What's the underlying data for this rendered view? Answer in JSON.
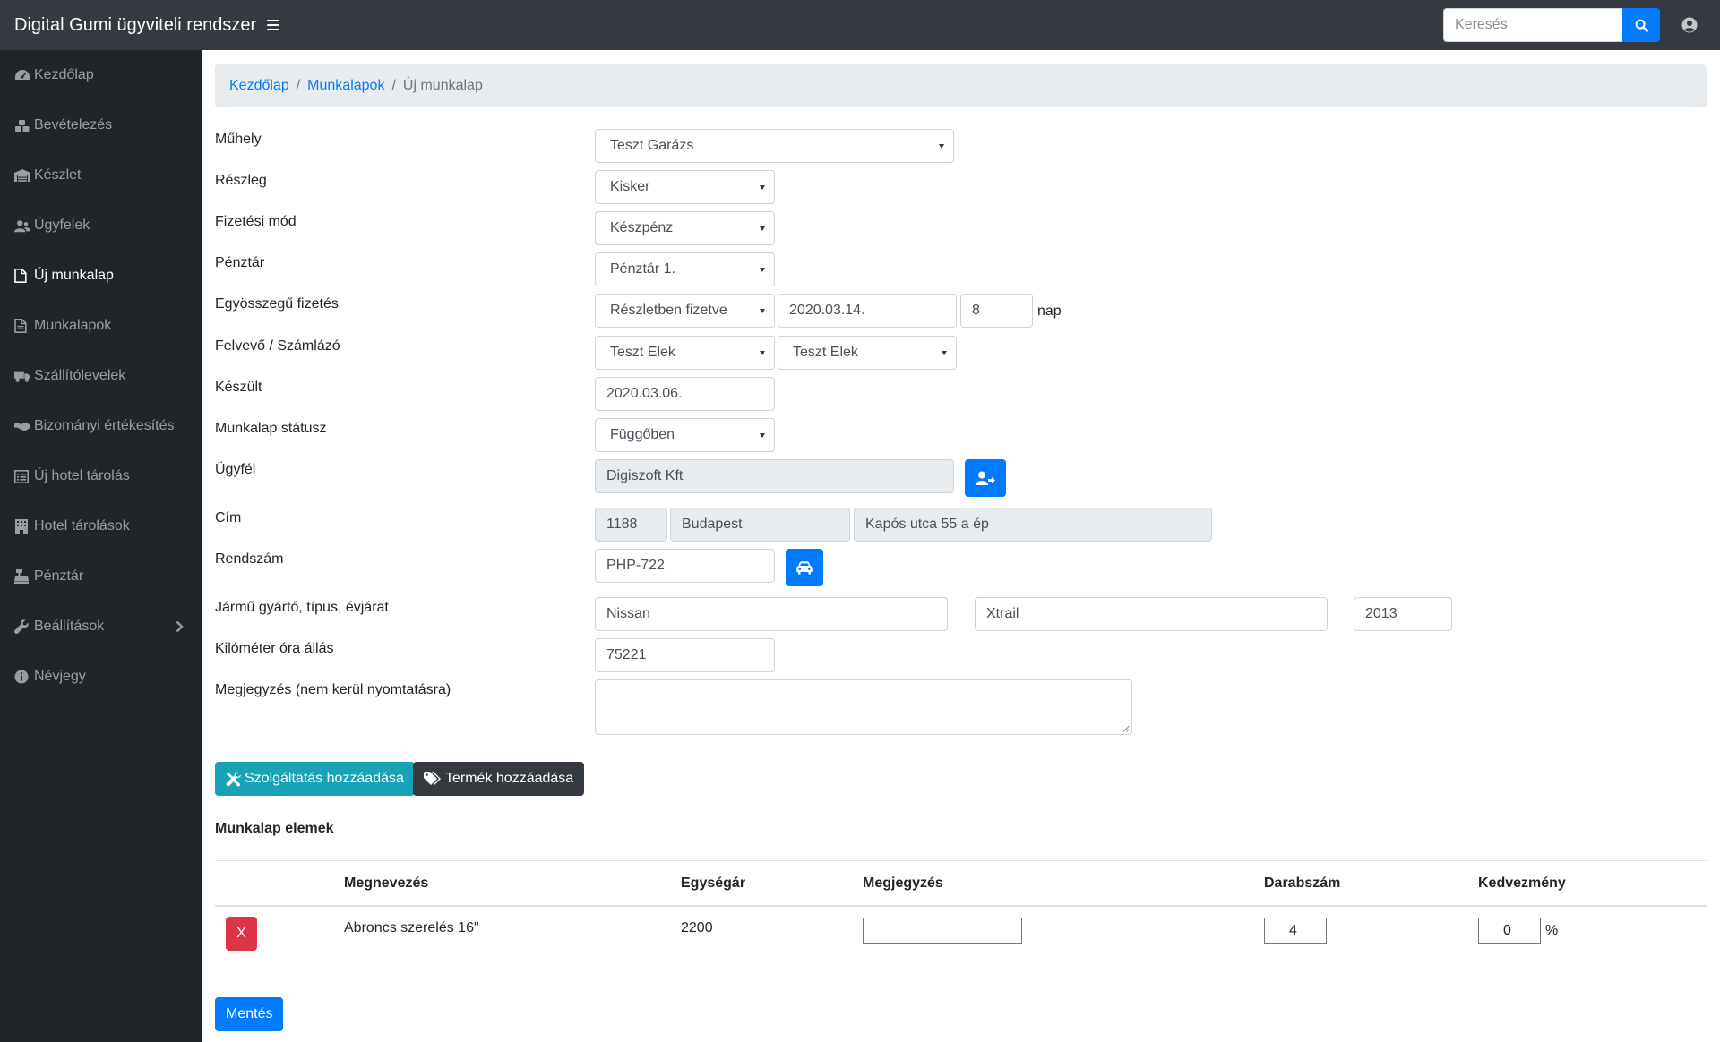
{
  "app": {
    "title": "Digital Gumi ügyviteli rendszer",
    "search_placeholder": "Keresés"
  },
  "sidebar": {
    "items": [
      {
        "label": "Kezdőlap",
        "icon": "tachometer-icon"
      },
      {
        "label": "Bevételezés",
        "icon": "cubes-icon"
      },
      {
        "label": "Készlet",
        "icon": "warehouse-icon"
      },
      {
        "label": "Ügyfelek",
        "icon": "users-icon"
      },
      {
        "label": "Új munkalap",
        "icon": "file-icon",
        "active": true
      },
      {
        "label": "Munkalapok",
        "icon": "file-text-icon"
      },
      {
        "label": "Szállítólevelek",
        "icon": "truck-icon"
      },
      {
        "label": "Bizományi értékesítés",
        "icon": "handshake-icon"
      },
      {
        "label": "Új hotel tárolás",
        "icon": "list-icon"
      },
      {
        "label": "Hotel tárolások",
        "icon": "building-icon"
      },
      {
        "label": "Pénztár",
        "icon": "cash-register-icon"
      },
      {
        "label": "Beállítások",
        "icon": "wrench-icon"
      },
      {
        "label": "Névjegy",
        "icon": "info-icon"
      }
    ]
  },
  "breadcrumb": {
    "home": "Kezdőlap",
    "worksheets": "Munkalapok",
    "current": "Új munkalap"
  },
  "form": {
    "muhely": {
      "label": "Műhely",
      "value": "Teszt Garázs"
    },
    "reszleg": {
      "label": "Részleg",
      "value": "Kisker"
    },
    "fizetesi_mod": {
      "label": "Fizetési mód",
      "value": "Készpénz"
    },
    "penztar": {
      "label": "Pénztár",
      "value": "Pénztár 1."
    },
    "egyosszegu": {
      "label": "Egyösszegű fizetés",
      "value": "Részletben fizetve",
      "date": "2020.03.14.",
      "days": "8",
      "days_suffix": "nap"
    },
    "felvevo": {
      "label": "Felvevő / Számlázó",
      "felvevo": "Teszt Elek",
      "szamlazo": "Teszt Elek"
    },
    "keszult": {
      "label": "Készült",
      "value": "2020.03.06."
    },
    "statusz": {
      "label": "Munkalap státusz",
      "value": "Függőben"
    },
    "ugyfel": {
      "label": "Ügyfél",
      "value": "Digiszoft Kft"
    },
    "cim": {
      "label": "Cím",
      "zip": "1188",
      "city": "Budapest",
      "street": "Kapós utca 55 a ép"
    },
    "rendszam": {
      "label": "Rendszám",
      "value": "PHP-722"
    },
    "jarmu": {
      "label": "Jármű gyártó, típus, évjárat",
      "make": "Nissan",
      "model": "Xtrail",
      "year": "2013"
    },
    "km": {
      "label": "Kilóméter óra állás",
      "value": "75221"
    },
    "megjegyzes": {
      "label": "Megjegyzés (nem kerül nyomtatásra)",
      "value": ""
    }
  },
  "buttons": {
    "add_service": "Szolgáltatás hozzáadása",
    "add_product": "Termék hozzáadása",
    "save": "Mentés",
    "remove": "X"
  },
  "items_section": {
    "title": "Munkalap elemek",
    "columns": [
      "Megnevezés",
      "Egységár",
      "Megjegyzés",
      "Darabszám",
      "Kedvezmény"
    ],
    "rows": [
      {
        "name": "Abroncs szerelés 16\"",
        "unit_price": "2200",
        "note": "",
        "quantity": "4",
        "discount": "0",
        "discount_suffix": "%"
      }
    ]
  },
  "colors": {
    "navbar": "#343a40",
    "sidebar": "#212529",
    "primary": "#007bff",
    "info": "#17a2b8",
    "danger": "#dc3545"
  }
}
